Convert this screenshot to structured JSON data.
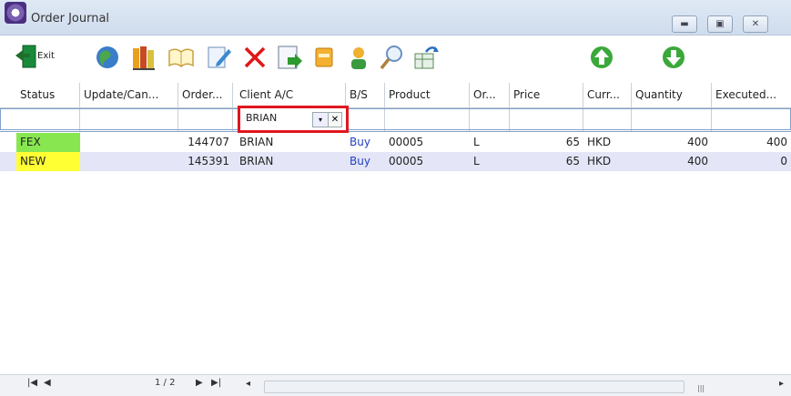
{
  "window": {
    "title": "Order Journal"
  },
  "toolbar": {
    "exit_label": "Exit"
  },
  "columns": [
    "Status",
    "Update/Can...",
    "Order...",
    "Client A/C",
    "B/S",
    "Product",
    "Or...",
    "Price",
    "Curr...",
    "Quantity",
    "Executed..."
  ],
  "filter": {
    "client": "BRIAN",
    "dropdown_glyph": "▾",
    "clear_glyph": "✕"
  },
  "rows": [
    {
      "status": "FEX",
      "update": "",
      "order": "144707",
      "client": "BRIAN",
      "bs": "Buy",
      "product": "00005",
      "or": "L",
      "price": "65",
      "curr": "HKD",
      "quantity": "400",
      "executed": "400"
    },
    {
      "status": "NEW",
      "update": "",
      "order": "145391",
      "client": "BRIAN",
      "bs": "Buy",
      "product": "00005",
      "or": "L",
      "price": "65",
      "curr": "HKD",
      "quantity": "400",
      "executed": "0"
    }
  ],
  "status_colors": {
    "FEX": "#88e650",
    "NEW": "#ffff33"
  },
  "row_colors": [
    "#ffffff",
    "#e4e6f7"
  ],
  "pager": {
    "text": "1 / 2"
  },
  "icons": [
    "exit-icon",
    "globe-icon",
    "books-icon",
    "open-book-icon",
    "edit-icon",
    "delete-icon",
    "export-icon",
    "calculator-icon",
    "user-icon",
    "search-icon",
    "refresh-icon",
    "scroll-up-icon",
    "scroll-down-icon"
  ]
}
